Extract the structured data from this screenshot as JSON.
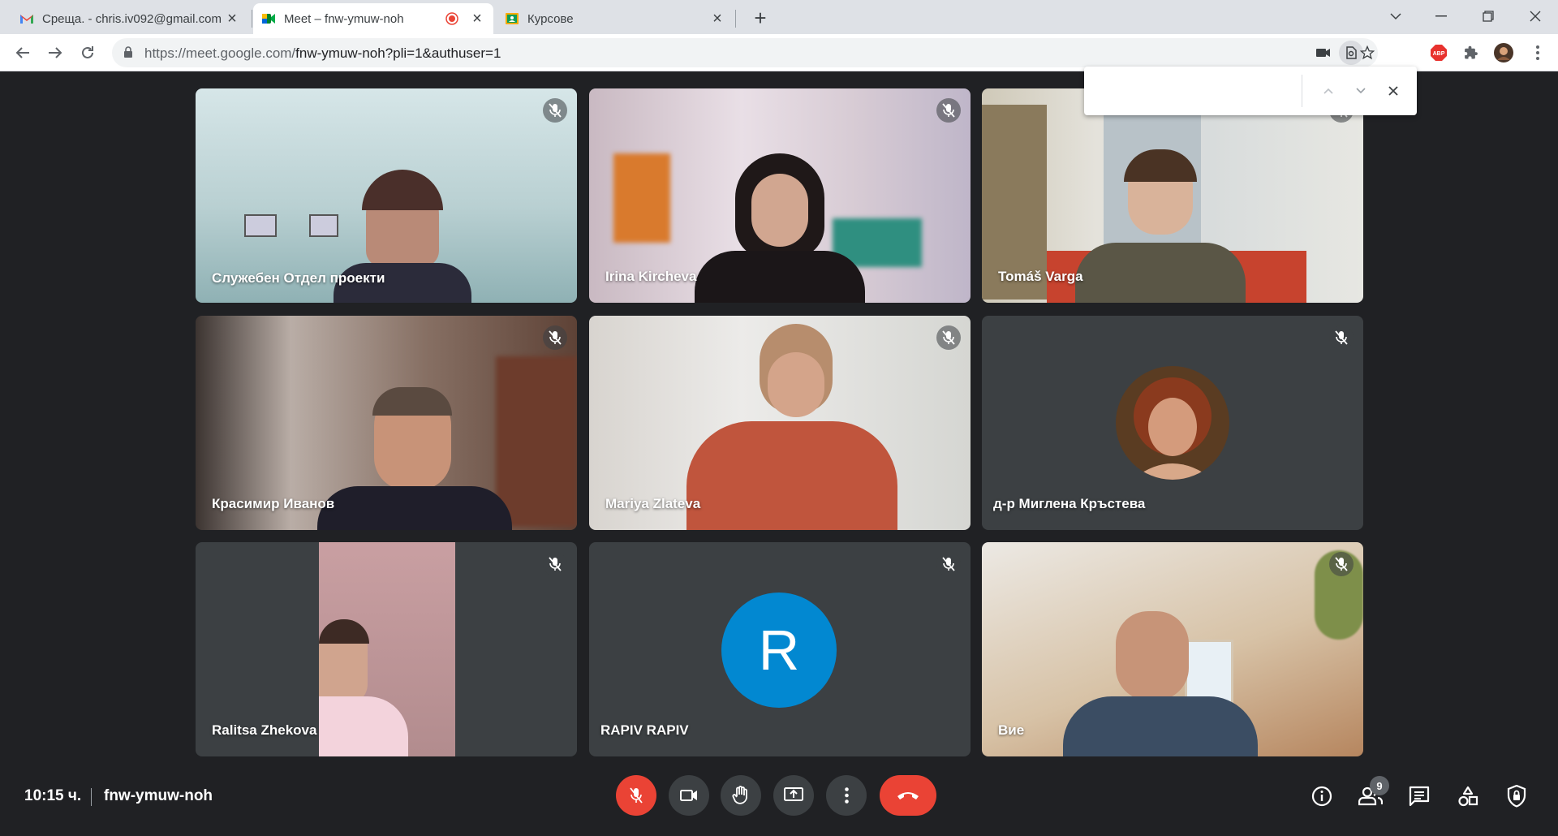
{
  "browser": {
    "tabs": [
      {
        "title": "Среща. - chris.iv092@gmail.com",
        "icon": "gmail-icon"
      },
      {
        "title": "Meet – fnw-ymuw-noh",
        "icon": "meet-icon",
        "recording": true
      },
      {
        "title": "Курсове",
        "icon": "classroom-icon"
      }
    ],
    "url": {
      "host": "https://meet.google.com/",
      "path": "fnw-ymuw-noh?pli=1&authuser=1"
    },
    "extension_badge": "ABP"
  },
  "meeting": {
    "time": "10:15 ч.",
    "code": "fnw-ymuw-noh",
    "participant_count": "9",
    "tiles": [
      {
        "name": "Служебен Отдел проекти",
        "muted": true,
        "type": "video"
      },
      {
        "name": "Irina Kircheva",
        "muted": true,
        "type": "video"
      },
      {
        "name": "Tomáš Varga",
        "muted": true,
        "type": "video"
      },
      {
        "name": "Красимир Иванов",
        "muted": true,
        "type": "video"
      },
      {
        "name": "Mariya Zlateva",
        "muted": true,
        "type": "video"
      },
      {
        "name": "д-р Миглена Кръстева",
        "muted": true,
        "type": "photo-avatar"
      },
      {
        "name": "Ralitsa Zhekova",
        "muted": true,
        "type": "video"
      },
      {
        "name": "RAPIV RAPIV",
        "muted": true,
        "type": "letter-avatar",
        "letter": "R"
      },
      {
        "name": "Вие",
        "muted": true,
        "type": "video"
      }
    ]
  },
  "colors": {
    "accent_red": "#ea4335",
    "avatar_blue": "#0288d1",
    "background": "#202124",
    "tile": "#3c4043"
  }
}
